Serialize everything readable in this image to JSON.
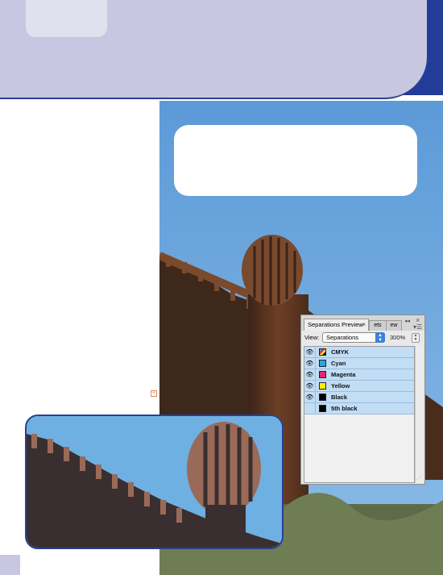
{
  "panel": {
    "title": "Separations Preview",
    "hidden_tab_1": "ets",
    "hidden_tab_2": "ew",
    "close_symbol": "×",
    "view_label": "View:",
    "view_value": "Separations",
    "zoom": "300%"
  },
  "inks": [
    {
      "name": "CMYK",
      "visible": true,
      "swatch_color": "cmyk"
    },
    {
      "name": "Cyan",
      "visible": true,
      "swatch_color": "#29a7e1"
    },
    {
      "name": "Magenta",
      "visible": true,
      "swatch_color": "#e4237a"
    },
    {
      "name": "Yellow",
      "visible": true,
      "swatch_color": "#ffec00"
    },
    {
      "name": "Black",
      "visible": true,
      "swatch_color": "#000000"
    },
    {
      "name": "5th black",
      "visible": false,
      "swatch_color": "#000000"
    }
  ],
  "colors": {
    "band_dark": "#233c98",
    "band_light": "#c7c7e1",
    "sky": "#6fb0e2",
    "rust": "#7a4a2e",
    "row_highlight": "#c2ddf6"
  },
  "icons": {
    "eye": "eye-icon",
    "collapse": "double-chevron-icon",
    "menu": "panel-menu-icon",
    "close": "close-icon",
    "anchor": "anchor-marker-icon"
  }
}
